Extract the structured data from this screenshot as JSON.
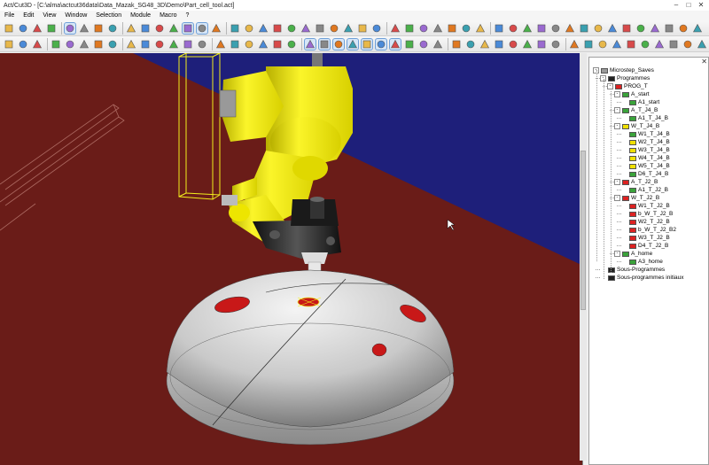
{
  "window": {
    "title": "Act/Cut3D - [C:\\alma\\actcut36data\\Data_Mazak_SG48_3D\\Demo\\Part_cell_tool.act]",
    "controls": [
      "–",
      "□",
      "✕"
    ]
  },
  "menu": [
    "File",
    "Edit",
    "View",
    "Window",
    "Selection",
    "Module",
    "Macro",
    "?"
  ],
  "colors": {
    "floor": "#6a1c18",
    "wall": "#1e1f7a",
    "robot": "#f3ee1c",
    "dome": "#c8c8c8",
    "selection": "#6fa0d8"
  },
  "tree": {
    "close": "✕",
    "root": "Microstep_Saves",
    "items": [
      {
        "label": "Microstep_Saves",
        "icon": "gray",
        "level": 0,
        "exp": "-"
      },
      {
        "label": "Programmes",
        "icon": "black",
        "level": 1,
        "exp": "-"
      },
      {
        "label": "PROG_T",
        "icon": "red",
        "level": 2,
        "exp": "-"
      },
      {
        "label": "A_start",
        "icon": "green",
        "level": 3,
        "exp": "-"
      },
      {
        "label": "A1_start",
        "icon": "green",
        "level": 4,
        "exp": ""
      },
      {
        "label": "A_T_J4_B",
        "icon": "green",
        "level": 3,
        "exp": "-"
      },
      {
        "label": "A1_T_J4_B",
        "icon": "green",
        "level": 4,
        "exp": ""
      },
      {
        "label": "W_T_J4_B",
        "icon": "yellow",
        "level": 3,
        "exp": "-"
      },
      {
        "label": "W1_T_J4_B",
        "icon": "green",
        "level": 4,
        "exp": ""
      },
      {
        "label": "W2_T_J4_B",
        "icon": "yellow",
        "level": 4,
        "exp": ""
      },
      {
        "label": "W3_T_J4_B",
        "icon": "yellow",
        "level": 4,
        "exp": ""
      },
      {
        "label": "W4_T_J4_B",
        "icon": "yellow",
        "level": 4,
        "exp": ""
      },
      {
        "label": "W5_T_J4_B",
        "icon": "yellow",
        "level": 4,
        "exp": ""
      },
      {
        "label": "D6_T_J4_B",
        "icon": "green",
        "level": 4,
        "exp": ""
      },
      {
        "label": "A_T_J2_B",
        "icon": "red",
        "level": 3,
        "exp": "-"
      },
      {
        "label": "A1_T_J2_B",
        "icon": "green",
        "level": 4,
        "exp": ""
      },
      {
        "label": "W_T_J2_B",
        "icon": "red",
        "level": 3,
        "exp": "-"
      },
      {
        "label": "W1_T_J2_B",
        "icon": "red",
        "level": 4,
        "exp": ""
      },
      {
        "label": "b_W_T_J2_B",
        "icon": "red",
        "level": 4,
        "exp": ""
      },
      {
        "label": "W2_T_J2_B",
        "icon": "red",
        "level": 4,
        "exp": ""
      },
      {
        "label": "b_W_T_J2_B2",
        "icon": "red",
        "level": 4,
        "exp": ""
      },
      {
        "label": "W3_T_J2_B",
        "icon": "red",
        "level": 4,
        "exp": ""
      },
      {
        "label": "D4_T_J2_B",
        "icon": "red",
        "level": 4,
        "exp": ""
      },
      {
        "label": "A_home",
        "icon": "green",
        "level": 3,
        "exp": "-"
      },
      {
        "label": "A3_home",
        "icon": "green",
        "level": 4,
        "exp": ""
      },
      {
        "label": "Sous-Programmes",
        "icon": "black",
        "level": 1,
        "exp": ""
      },
      {
        "label": "Sous-programmes initiaux",
        "icon": "black",
        "level": 1,
        "exp": ""
      }
    ]
  },
  "toolbars": {
    "row1_icons": [
      "open-icon",
      "save-icon",
      "print-icon",
      "cut-icon",
      "copy-icon",
      "paste-icon",
      "select-icon",
      "undo-icon",
      "redo-icon",
      "delete-icon",
      "trim-icon",
      "extend-icon",
      "join-icon",
      "layer-icon",
      "render-icon",
      "material-icon",
      "rotate-icon",
      "pan-icon",
      "zoom-in-icon",
      "zoom-out-icon",
      "zoom-window-icon",
      "view-front-icon",
      "view-top-icon",
      "view-side-icon",
      "view-iso-icon",
      "view-back-icon",
      "fit-icon",
      "grid-icon",
      "snap-icon",
      "wire-icon",
      "shade-icon",
      "robot-icon",
      "tool-icon",
      "path-icon",
      "simulate-icon",
      "collision-icon",
      "export-icon",
      "settings-icon"
    ],
    "row2_icons": [
      "point-icon",
      "line-icon",
      "arc-icon",
      "circle-icon",
      "rect-icon",
      "poly-icon",
      "spline-icon",
      "text-icon",
      "dim-icon",
      "hatch-icon",
      "mirror-icon",
      "array-icon",
      "move-icon",
      "scale-icon",
      "align-icon",
      "measure-icon",
      "axis-icon",
      "frame-icon",
      "weld-icon",
      "cut-path-icon",
      "approach-icon",
      "retract-icon",
      "teach-icon",
      "play-icon",
      "step-icon",
      "stop-icon",
      "record-icon",
      "list-icon",
      "table-icon",
      "help-icon"
    ]
  }
}
